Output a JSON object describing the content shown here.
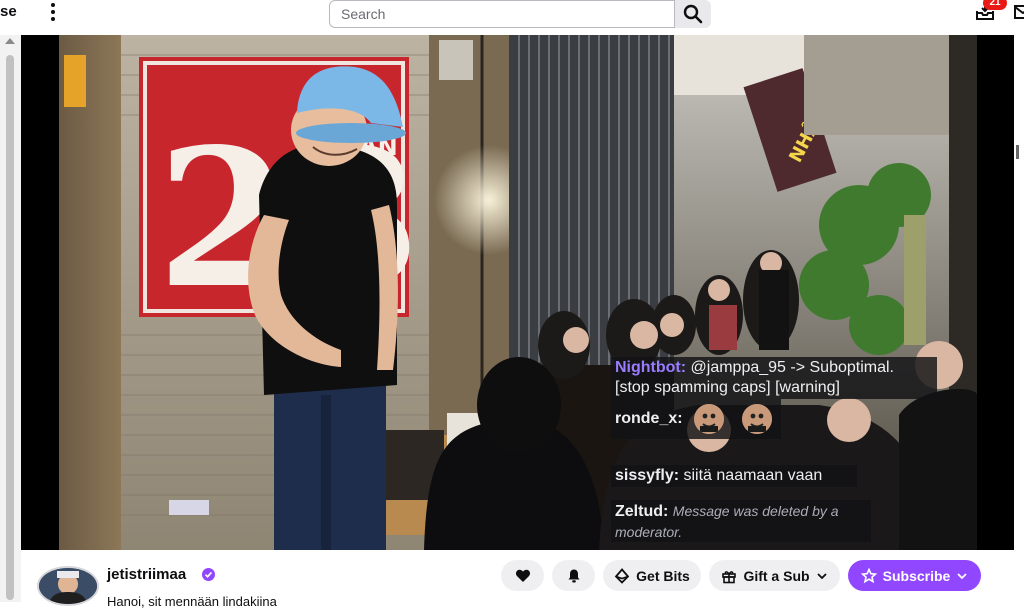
{
  "topbar": {
    "brand_fragment": "se",
    "search": {
      "placeholder": "Search",
      "value": ""
    },
    "notifications_count": "21",
    "icons": {
      "more": "kebab-icon",
      "search": "search-icon",
      "inbox": "inbox-icon",
      "whispers": "whisper-icon"
    }
  },
  "video": {
    "sign_number": "23",
    "chat": [
      {
        "user": "Nightbot:",
        "user_color": "#9a7cff",
        "text": "@jamppa_95 -> Suboptimal. [stop spamming caps] [warning]"
      },
      {
        "user": "ronde_x:",
        "user_color": "#efeff1",
        "text": "",
        "emotes": 2
      },
      {
        "user": "sissyfly:",
        "user_color": "#efeff1",
        "text": "siitä naamaan vaan"
      },
      {
        "user": "Zeltud:",
        "user_color": "#efeff1",
        "text": "Message was deleted by a moderator.",
        "deleted": true
      }
    ]
  },
  "channel": {
    "name": "jetistriimaa",
    "verified": true,
    "title": "Hanoi, sit mennään lindakiina",
    "accent": "#9147ff"
  },
  "actions": {
    "follow_icon": "heart-icon",
    "notify_icon": "bell-icon",
    "bits_label": "Get Bits",
    "gift_label": "Gift a Sub",
    "subscribe_label": "Subscribe"
  }
}
